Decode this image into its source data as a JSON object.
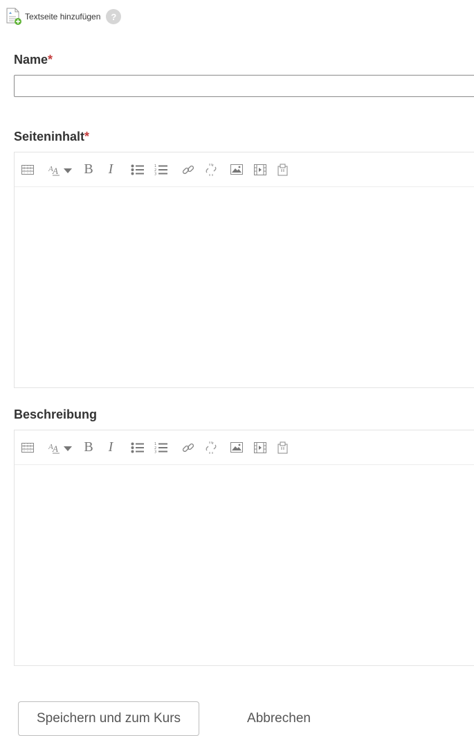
{
  "header": {
    "title": "Textseite hinzufügen",
    "help_glyph": "?",
    "icon": "document-add-icon"
  },
  "form": {
    "name_label": "Name",
    "content_label": "Seiteninhalt",
    "description_label": "Beschreibung",
    "required_marker": "*",
    "name_value": "",
    "content_value": "",
    "description_value": ""
  },
  "toolbar_items": [
    "toolbar-toggle-icon",
    "font-size-icon",
    "bold-icon",
    "italic-icon",
    "unordered-list-icon",
    "ordered-list-icon",
    "link-icon",
    "unlink-icon",
    "image-icon",
    "media-icon",
    "manage-files-icon"
  ],
  "toolbar_glyphs": {
    "bold": "B",
    "italic": "I"
  },
  "buttons": {
    "save": "Speichern und zum Kurs",
    "cancel": "Abbrechen"
  },
  "colors": {
    "required": "#c43d3d",
    "icon": "#7a7a7a",
    "border": "#e3e3e3",
    "text": "#333333"
  }
}
